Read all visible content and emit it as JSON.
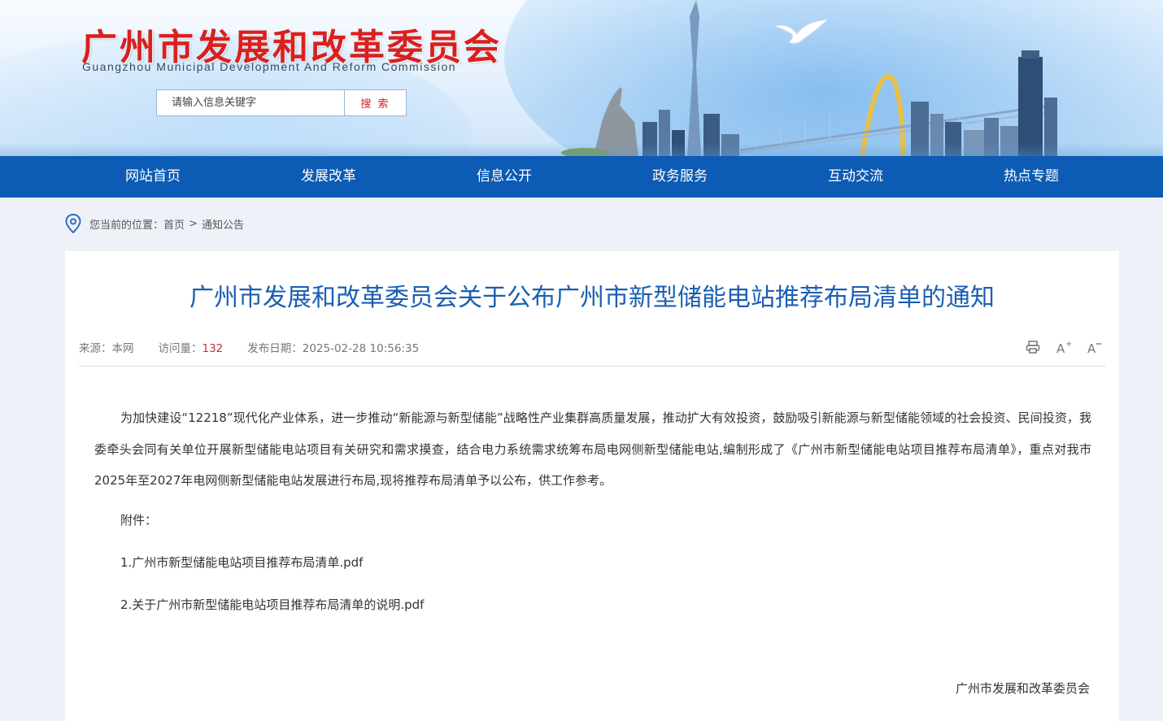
{
  "header": {
    "title": "广州市发展和改革委员会",
    "subtitle": "Guangzhou Municipal Development And Reform Commission",
    "search_placeholder": "请输入信息关键字",
    "search_button": "搜 索"
  },
  "nav": {
    "items": [
      "网站首页",
      "发展改革",
      "信息公开",
      "政务服务",
      "互动交流",
      "热点专题"
    ]
  },
  "breadcrumb": {
    "prefix": "您当前的位置：",
    "home": "首页",
    "separator": ">",
    "current": "通知公告"
  },
  "article": {
    "title": "广州市发展和改革委员会关于公布广州市新型储能电站推荐布局清单的通知",
    "meta": {
      "source_label": "来源：",
      "source": "本网",
      "visits_label": "访问量：",
      "visits": "132",
      "date_label": "发布日期：",
      "date": "2025-02-28 10:56:35"
    },
    "tools": {
      "print_icon": "printer-icon",
      "font_increase": "A+",
      "font_decrease": "A-"
    },
    "body": "为加快建设“12218”现代化产业体系，进一步推动“新能源与新型储能”战略性产业集群高质量发展，推动扩大有效投资，鼓励吸引新能源与新型储能领域的社会投资、民间投资，我委牵头会同有关单位开展新型储能电站项目有关研究和需求摸查，结合电力系统需求统筹布局电网侧新型储能电站,编制形成了《广州市新型储能电站项目推荐布局清单》，重点对我市2025年至2027年电网侧新型储能电站发展进行布局,现将推荐布局清单予以公布，供工作参考。",
    "attachments_label": "附件：",
    "attachments": [
      "1.广州市新型储能电站项目推荐布局清单.pdf",
      "2.关于广州市新型储能电站项目推荐布局清单的说明.pdf"
    ],
    "signature": "广州市发展和改革委员会"
  },
  "colors": {
    "brand_red": "#d9201f",
    "nav_blue": "#0c5bb4",
    "title_blue": "#1b5fb3",
    "highlight_red": "#c9302c"
  }
}
